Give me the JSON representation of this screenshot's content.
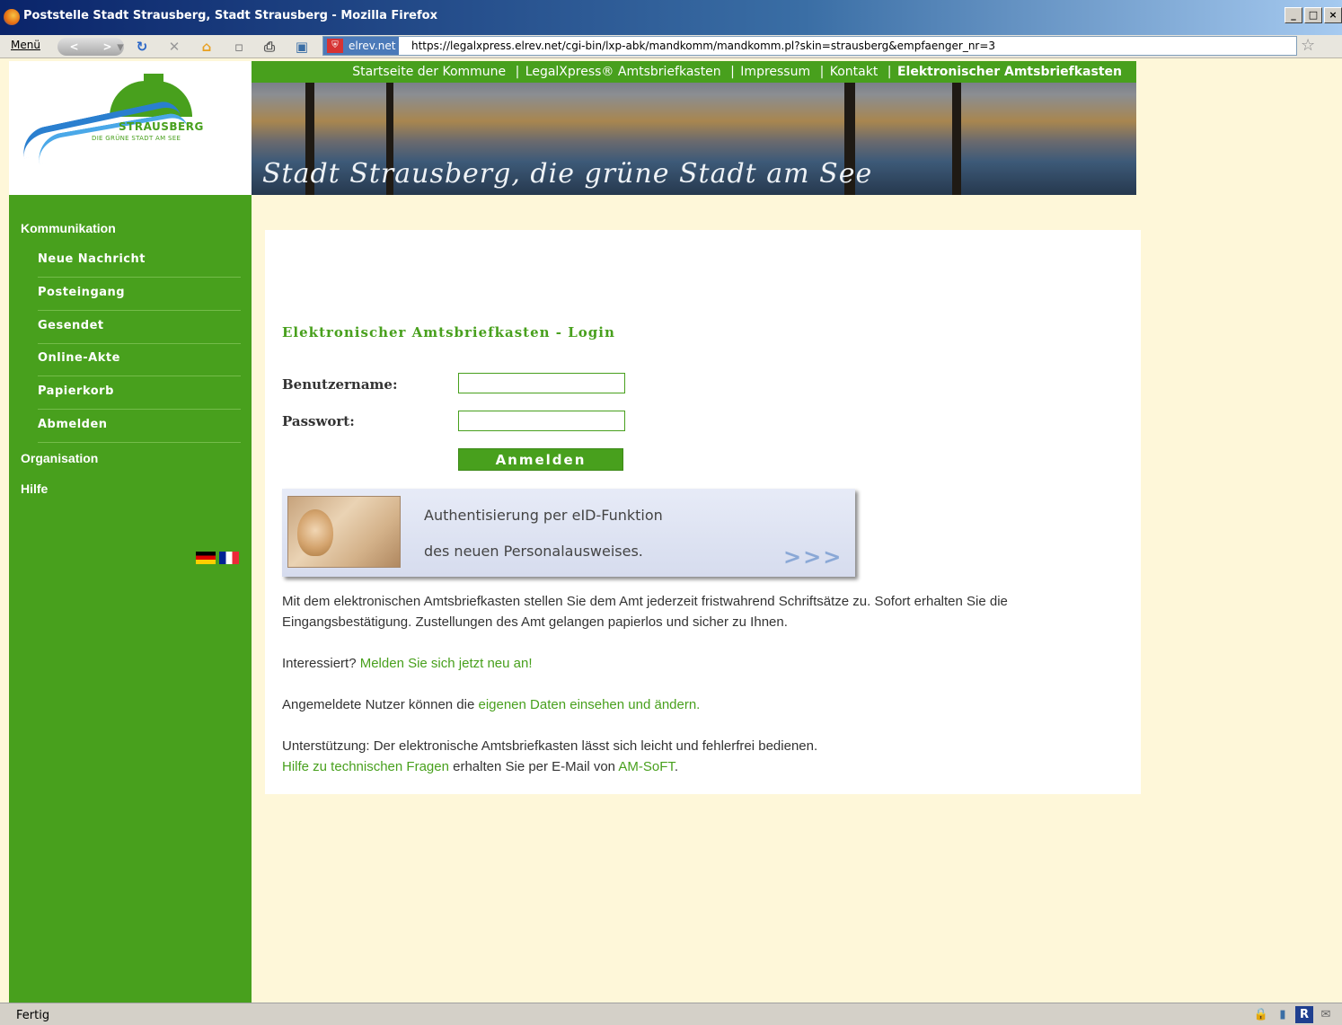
{
  "window": {
    "title": "Poststelle Stadt Strausberg, Stadt Strausberg - Mozilla Firefox",
    "buttons": [
      "_",
      "□",
      "×"
    ]
  },
  "toolbar": {
    "menu_label": "Menü",
    "back_label": "<",
    "forward_label": ">",
    "reload_icon": "reload-icon",
    "stop_icon": "stop-icon",
    "home_icon": "home-icon",
    "site_badge": "elrev.net",
    "url": "https://legalxpress.elrev.net/cgi-bin/lxp-abk/mandkomm/mandkomm.pl?skin=strausberg&empfaenger_nr=3"
  },
  "logo": {
    "name": "STRAUSBERG",
    "tagline": "DIE GRÜNE STADT AM SEE"
  },
  "topnav": {
    "items": [
      {
        "label": "Startseite der Kommune",
        "active": false
      },
      {
        "label": "LegalXpress® Amtsbriefkasten",
        "active": false
      },
      {
        "label": "Impressum",
        "active": false
      },
      {
        "label": "Kontakt",
        "active": false
      },
      {
        "label": "Elektronischer Amtsbriefkasten",
        "active": true
      }
    ],
    "separator": "|"
  },
  "banner": {
    "slogan": "Stadt Strausberg, die grüne Stadt am See"
  },
  "sidebar": {
    "sections": [
      {
        "label": "Kommunikation"
      },
      {
        "label": "Organisation"
      },
      {
        "label": "Hilfe"
      }
    ],
    "items": [
      {
        "label": "Neue Nachricht"
      },
      {
        "label": "Posteingang"
      },
      {
        "label": "Gesendet"
      },
      {
        "label": "Online-Akte"
      },
      {
        "label": "Papierkorb"
      },
      {
        "label": "Abmelden"
      }
    ]
  },
  "login": {
    "title": "Elektronischer Amtsbriefkasten - Login",
    "username_label": "Benutzername:",
    "username_value": "",
    "password_label": "Passwort:",
    "password_value": "",
    "submit_label": "Anmelden"
  },
  "eid": {
    "line1": "Authentisierung per eID-Funktion",
    "line2": "des neuen Personalausweises.",
    "arrow": ">>>"
  },
  "info": {
    "p1": "Mit dem elektronischen Amtsbriefkasten stellen Sie dem Amt jederzeit fristwahrend Schriftsätze zu. Sofort erhalten Sie die Eingangsbestätigung. Zustellungen des Amt gelangen papierlos und sicher zu Ihnen.",
    "p2_text": "Interessiert? ",
    "p2_link": "Melden Sie sich jetzt neu an!",
    "p3_text": "Angemeldete Nutzer können die ",
    "p3_link": "eigenen Daten einsehen und ändern.",
    "p4_line1": "Unterstützung: Der elektronische Amtsbriefkasten lässt sich leicht und fehlerfrei bedienen.",
    "p4_link1": "Hilfe zu technischen Fragen",
    "p4_mid": " erhalten Sie per E-Mail von ",
    "p4_link2": "AM-SoFT",
    "p4_end": "."
  },
  "status": {
    "text": "Fertig"
  },
  "colors": {
    "brand_green": "#48a01d",
    "page_bg": "#fef7d9",
    "link": "#48a01d"
  }
}
